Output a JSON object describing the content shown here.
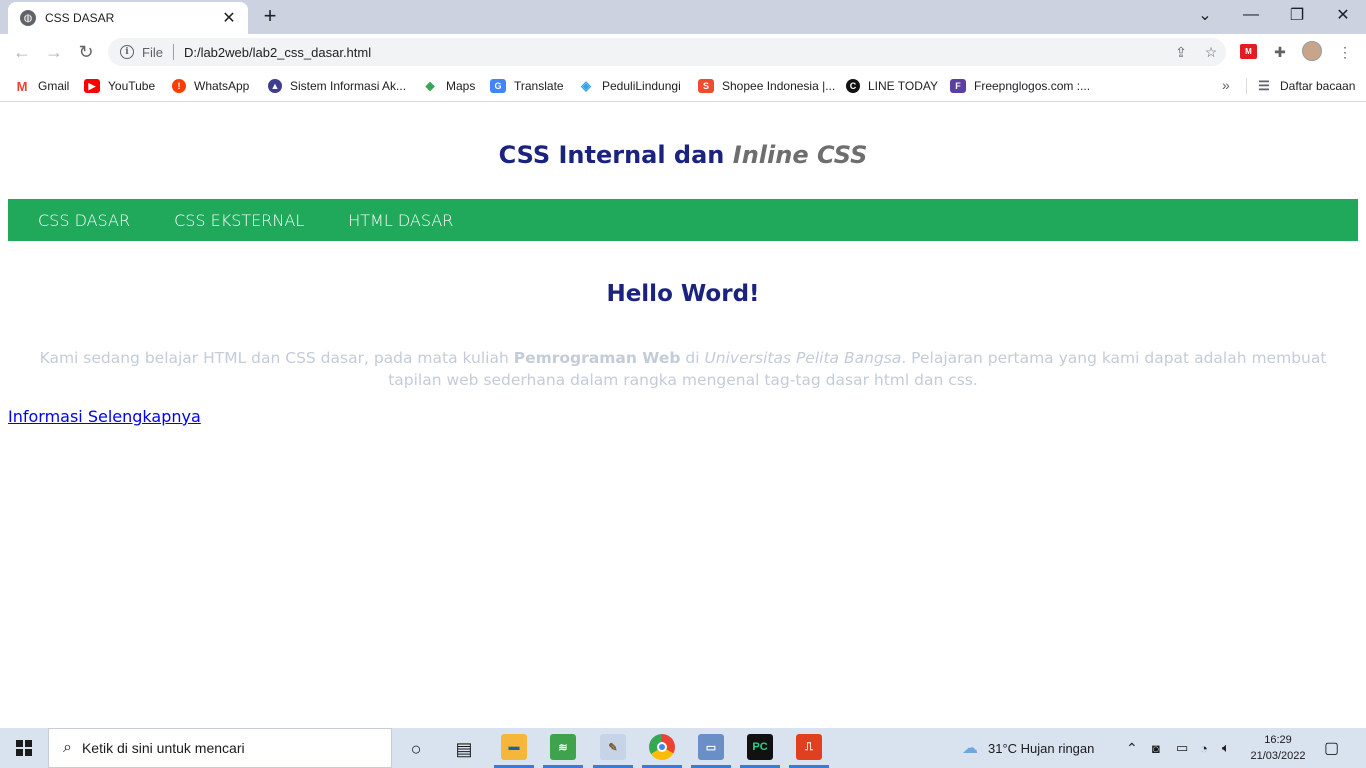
{
  "browser": {
    "tab_title": "CSS DASAR",
    "new_tab_symbol": "+",
    "close_symbol": "✕",
    "scheme_label": "File",
    "url": "D:/lab2web/lab2_css_dasar.html",
    "bookmarks": [
      {
        "label": "Gmail",
        "icon": "gmail-icon",
        "color": "#ea4335",
        "glyph": "M"
      },
      {
        "label": "YouTube",
        "icon": "youtube-icon",
        "color": "#ff0000",
        "glyph": "▶"
      },
      {
        "label": "WhatsApp",
        "icon": "whatsapp-icon",
        "color": "#ff3d00",
        "glyph": "!"
      },
      {
        "label": "Sistem Informasi Ak...",
        "icon": "university-icon",
        "color": "#3f3d8f",
        "glyph": "▲"
      },
      {
        "label": "Maps",
        "icon": "maps-icon",
        "color": "#34a853",
        "glyph": "◆"
      },
      {
        "label": "Translate",
        "icon": "translate-icon",
        "color": "#4285f4",
        "glyph": "G"
      },
      {
        "label": "PeduliLindungi",
        "icon": "pedulilindungi-icon",
        "color": "#3aa0e6",
        "glyph": "◈"
      },
      {
        "label": "Shopee Indonesia |...",
        "icon": "shopee-icon",
        "color": "#ee4d2d",
        "glyph": "S"
      },
      {
        "label": "LINE TODAY",
        "icon": "line-today-icon",
        "color": "#111111",
        "glyph": "C"
      },
      {
        "label": "Freepnglogos.com :...",
        "icon": "freepnglogos-icon",
        "color": "#5b3fa3",
        "glyph": "F"
      }
    ],
    "reading_list_label": "Daftar bacaan",
    "more_symbol": "»"
  },
  "page": {
    "heading_normal": "CSS Internal dan",
    "heading_italic": "Inline CSS",
    "nav": [
      "CSS DASAR",
      "CSS EKSTERNAL",
      "HTML DASAR"
    ],
    "hello": "Hello Word!",
    "para_1": "Kami sedang belajar HTML dan CSS dasar, pada mata kuliah ",
    "para_bold": "Pemrograman Web",
    "para_2": " di ",
    "para_italic": "Universitas Pelita Bangsa",
    "para_3": ". Pelajaran pertama yang kami dapat adalah membuat tapilan web sederhana dalam rangka mengenal tag-tag dasar html dan css.",
    "link": "Informasi Selengkapnya"
  },
  "taskbar": {
    "search_placeholder": "Ketik di sini untuk mencari",
    "weather": "31°C  Hujan ringan",
    "time": "16:29",
    "date": "21/03/2022"
  },
  "colors": {
    "heading": "#1a237e",
    "nav_bg": "#21a95b",
    "paragraph": "#c4ccd8",
    "link": "#0000ee"
  }
}
